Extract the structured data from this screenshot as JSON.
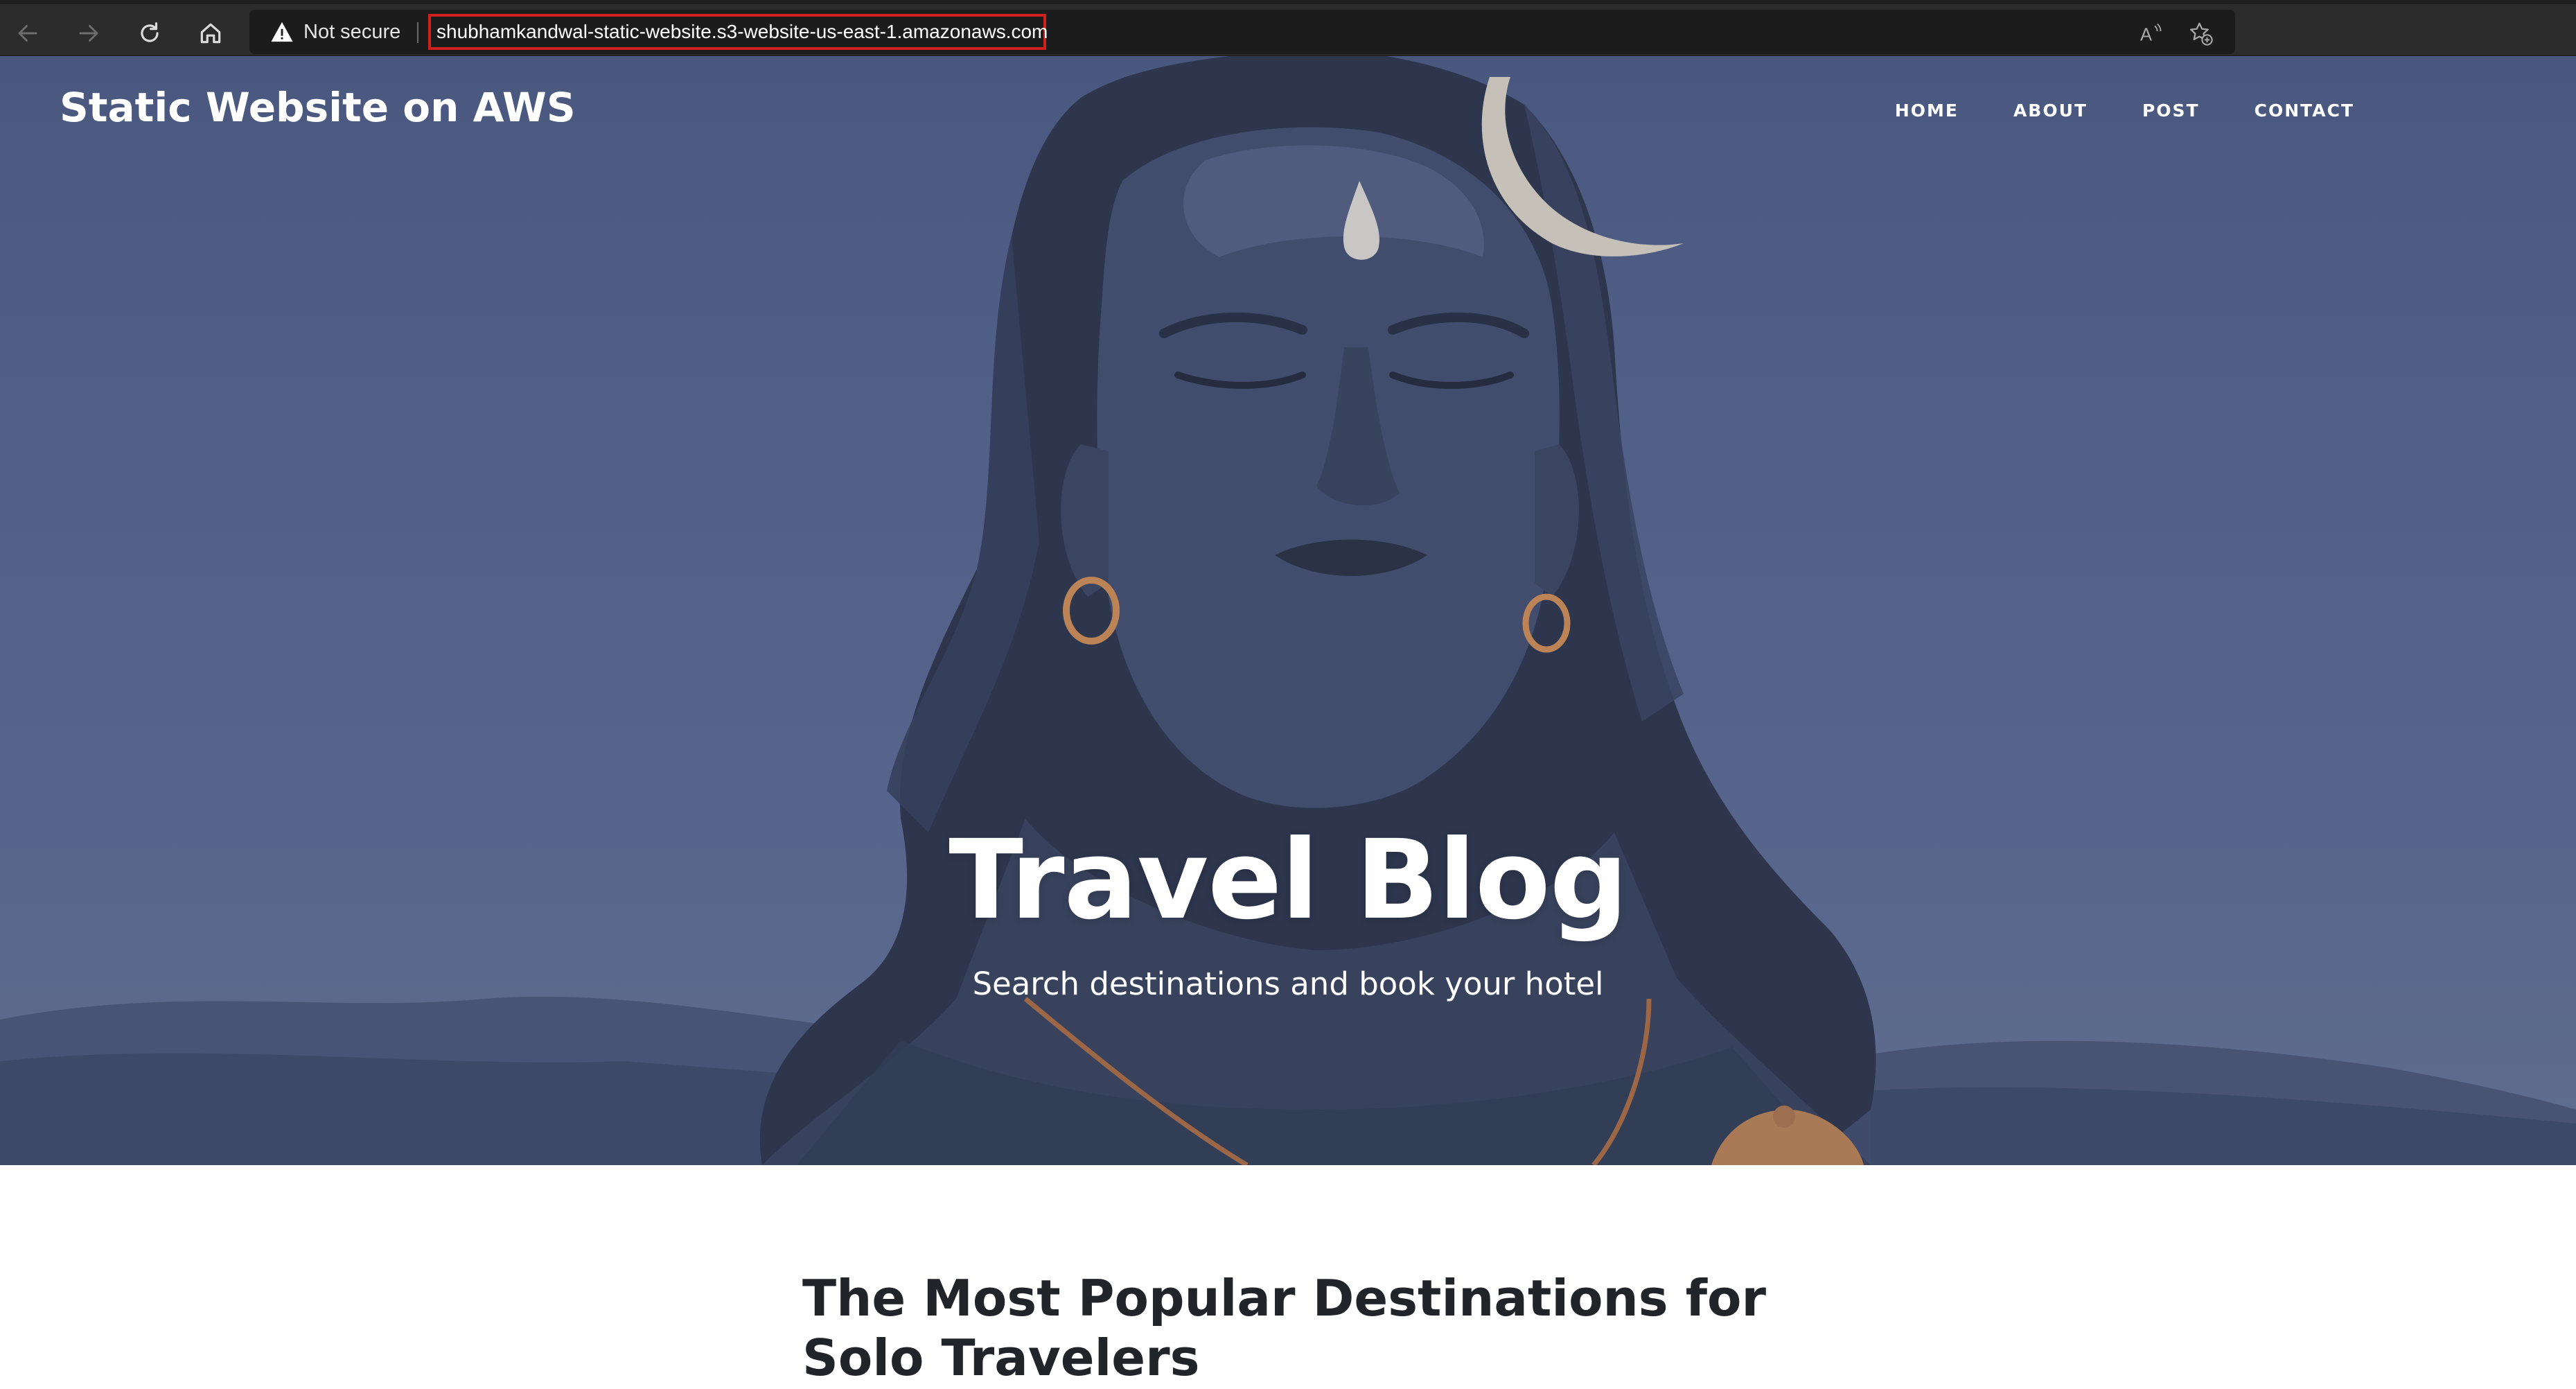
{
  "browser": {
    "security_label": "Not secure",
    "url": "shubhamkandwal-static-website.s3-website-us-east-1.amazonaws.com"
  },
  "site": {
    "brand": "Static Website on AWS",
    "nav": [
      "HOME",
      "ABOUT",
      "POST",
      "CONTACT"
    ]
  },
  "hero": {
    "title": "Travel Blog",
    "subtitle": "Search destinations and book your hotel"
  },
  "content": {
    "post_title": "The Most Popular Destinations for Solo Travelers"
  },
  "icons": {
    "back": "arrow-left-icon",
    "forward": "arrow-right-icon",
    "refresh": "refresh-icon",
    "home": "home-icon",
    "warning": "warning-icon",
    "read_aloud": "read-aloud-icon",
    "favorites": "add-favorite-icon"
  }
}
